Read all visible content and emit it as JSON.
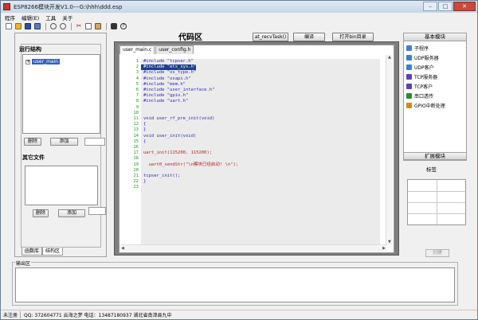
{
  "window": {
    "title": "ESP8266模块开发V1.0---G:\\hhh\\ddd.esp"
  },
  "menu": [
    "程序",
    "编辑(E)",
    "工具",
    "关于"
  ],
  "toolbar": {
    "icons": [
      "new-file-icon",
      "open-folder-icon",
      "save-icon",
      "save-all-icon",
      "undo-icon",
      "redo-icon",
      "cut-icon",
      "copy-icon",
      "paste-icon",
      "find-icon",
      "help-icon"
    ]
  },
  "left_panel": {
    "run_structure_label": "运行结构",
    "tree_root": "user_main",
    "delete_label": "删除",
    "add_label": "添加",
    "other_files_label": "其它文件",
    "delete2_label": "删除",
    "add2_label": "添加",
    "tabs": [
      "函数库",
      "结构区"
    ]
  },
  "center": {
    "title": "代码区",
    "buttons": [
      "at_recvTask()",
      "编译",
      "打开bin目录"
    ],
    "file_tabs": [
      "user_main.c",
      "user_config.h"
    ],
    "lines": [
      {
        "n": "1",
        "t": "#include \"tcpser.h\""
      },
      {
        "n": "2",
        "t": "#include \"ets_sys.h\"",
        "sel": true
      },
      {
        "n": "3",
        "t": "#include \"os_type.h\""
      },
      {
        "n": "4",
        "t": "#include \"osapi.h\""
      },
      {
        "n": "5",
        "t": "#include \"mem.h\""
      },
      {
        "n": "6",
        "t": "#include \"user_interface.h\""
      },
      {
        "n": "7",
        "t": "#include \"gpio.h\""
      },
      {
        "n": "8",
        "t": "#include \"uart.h\""
      },
      {
        "n": "9",
        "t": ""
      },
      {
        "n": "10",
        "t": ""
      },
      {
        "n": "11",
        "t": "void user_rf_pre_init(void)"
      },
      {
        "n": "12",
        "t": "{"
      },
      {
        "n": "13",
        "t": "}"
      },
      {
        "n": "14",
        "t": "void user_init(void)"
      },
      {
        "n": "15",
        "t": "{"
      },
      {
        "n": "16",
        "t": ""
      },
      {
        "n": "17",
        "t": "uart_init(115200, 115200);",
        "red": true
      },
      {
        "n": "18",
        "t": ""
      },
      {
        "n": "19",
        "t": "  uart0_sendStr(\"\\n模块已经启动! \\n\");",
        "red": true
      },
      {
        "n": "20",
        "t": ""
      },
      {
        "n": "21",
        "t": "tcpser_init();"
      },
      {
        "n": "22",
        "t": "}"
      },
      {
        "n": "23",
        "t": ""
      }
    ]
  },
  "right_panel": {
    "header": "基本模块",
    "items": [
      {
        "label": "子程序",
        "icon": "subroutine-icon",
        "color": "#4a7ad6"
      },
      {
        "label": "UDP服务器",
        "icon": "udp-server-icon",
        "color": "#3a7fd0"
      },
      {
        "label": "UDP客户",
        "icon": "udp-client-icon",
        "color": "#3a7fd0"
      },
      {
        "label": "TCP服务器",
        "icon": "tcp-server-icon",
        "color": "#5c3fb8"
      },
      {
        "label": "TCP客户",
        "icon": "tcp-client-icon",
        "color": "#5c3fb8"
      },
      {
        "label": "串口透传",
        "icon": "serial-passthrough-icon",
        "color": "#2a8a3a"
      },
      {
        "label": "GPIO中断处理",
        "icon": "gpio-interrupt-icon",
        "color": "#d08a1e"
      }
    ],
    "footer": "扩展模块",
    "tag_label": "标签",
    "create_button": "创建"
  },
  "output": {
    "label": "输出区"
  },
  "status": {
    "left": "未注册",
    "right": "QQ: 372604771  云海之梦  电话：13487180937  湖北省南漳县九中"
  }
}
